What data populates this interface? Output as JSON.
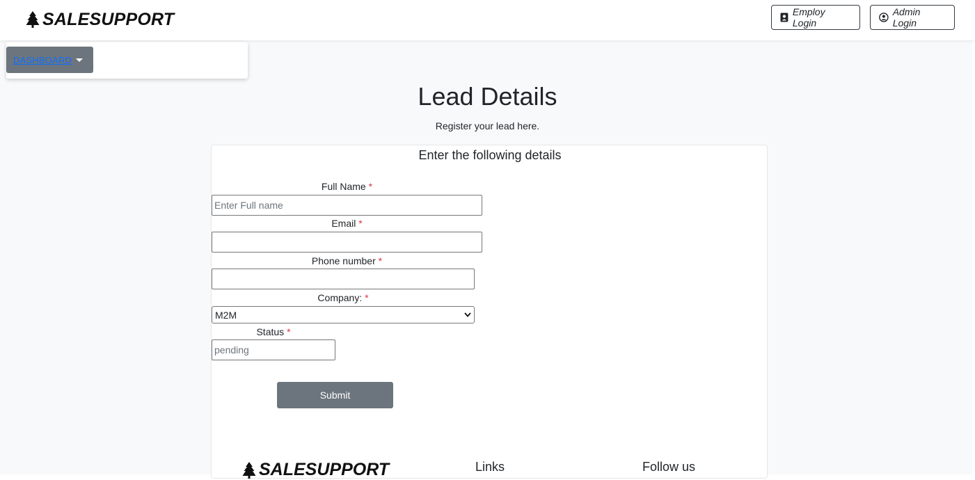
{
  "header": {
    "brand": "SALESUPPORT",
    "employ_login": "Employ Login",
    "admin_login": "Admin Login"
  },
  "dashboard": {
    "label": "DASHBOARD"
  },
  "page": {
    "title": "Lead Details",
    "subtitle": "Register your lead here."
  },
  "form": {
    "heading": "Enter the following details",
    "full_name_label": "Full Name",
    "full_name_placeholder": "Enter Full name",
    "email_label": "Email",
    "phone_label": "Phone number",
    "company_label": "Company:",
    "company_value": "M2M",
    "status_label": "Status",
    "status_placeholder": "pending",
    "required_mark": "*",
    "submit": "Submit"
  },
  "footer": {
    "brand": "SALESUPPORT",
    "links_heading": "Links",
    "follow_heading": "Follow us"
  },
  "colors": {
    "button_grey": "#6c757d",
    "link_blue": "#0d6efd",
    "required_red": "#dc3545",
    "background": "#f8f9fa"
  }
}
